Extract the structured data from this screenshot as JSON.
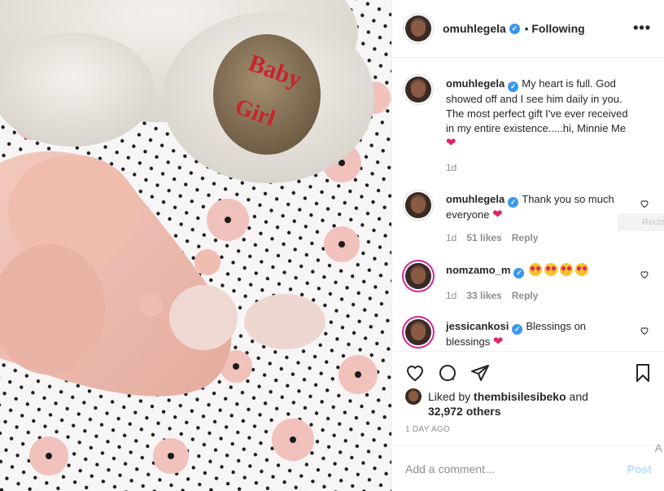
{
  "post": {
    "author": "omuhlegela",
    "separator": "•",
    "follow_status": "Following",
    "more_icon": "•••",
    "photo_text_line1": "Baby",
    "photo_text_line2": "Girl"
  },
  "caption": {
    "user": "omuhlegela",
    "text": "My heart is full. God showed off and I see him daily in you. The most perfect gift I've ever received in my entire existence.....hi, Minnie Me",
    "time": "1d"
  },
  "comments": [
    {
      "user": "omuhlegela",
      "text": "Thank you so much everyone",
      "time": "1d",
      "likes": "51 likes",
      "reply": "Reply"
    },
    {
      "user": "nomzamo_m",
      "text": "",
      "time": "1d",
      "likes": "33 likes",
      "reply": "Reply"
    },
    {
      "user": "jessicankosi",
      "text": "Blessings on blessings",
      "time": "",
      "likes": "",
      "reply": ""
    }
  ],
  "ghost_label": "Recta",
  "liked_by": {
    "prefix": "Liked by",
    "user": "thembisilesibeko",
    "and": "and",
    "others": "32,972 others"
  },
  "timestamp": "1 DAY AGO",
  "add_comment": {
    "placeholder": "Add a comment...",
    "post_label": "Post"
  },
  "corner_text": "A",
  "colors": {
    "link": "#3897f0",
    "heart": "#e0245e",
    "muted": "#8e8e8e",
    "post_disabled": "#b2dffc"
  }
}
